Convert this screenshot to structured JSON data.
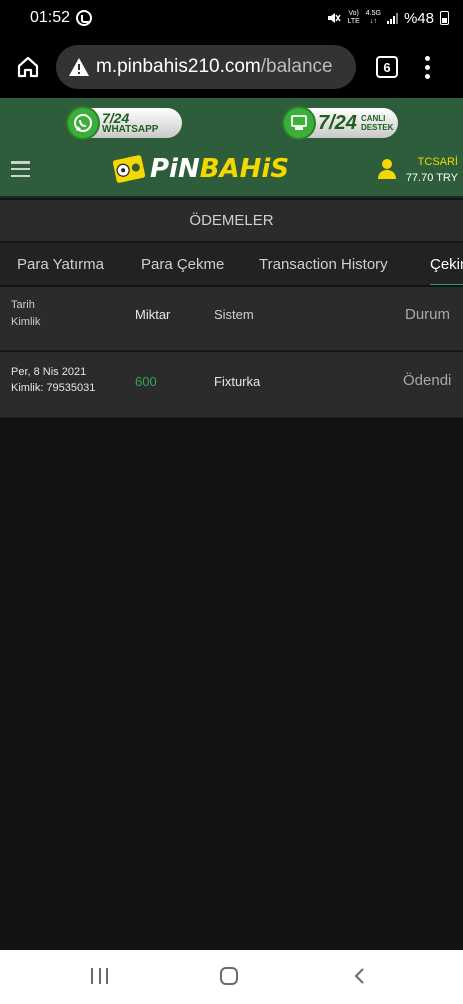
{
  "status_bar": {
    "time": "01:52",
    "network_top": "Vo)",
    "network_bottom": "LTE",
    "speed_top": "4.5G",
    "speed_bottom": "↓↑",
    "battery": "%48"
  },
  "browser": {
    "url_domain": "m.pinbahis210.com",
    "url_path": "/balance",
    "tab_count": "6"
  },
  "site_header": {
    "promo_whatsapp_line1": "7/24",
    "promo_whatsapp_line2": "WHATSAPP",
    "promo_live_big": "7/24",
    "promo_live_line1": "CANLI",
    "promo_live_line2": "DESTEK",
    "logo_white": "PiN",
    "logo_yellow": "BAHiS",
    "username": "TCSARİ",
    "balance": "77.70 TRY",
    "colors": {
      "header_bg": "#2d5d3a",
      "accent_yellow": "#f5d800",
      "accent_green": "#23a15a"
    }
  },
  "page": {
    "section_title": "ÖDEMELER",
    "tabs": [
      {
        "label": "Para Yatırma"
      },
      {
        "label": "Para Çekme"
      },
      {
        "label": "Transaction History"
      },
      {
        "label": "Çekim",
        "active": true
      }
    ]
  },
  "table": {
    "headers": {
      "date": "Tarih",
      "id": "Kimlik",
      "amount": "Miktar",
      "system": "Sistem",
      "status": "Durum"
    },
    "rows": [
      {
        "date": "Per, 8 Nis 2021",
        "id": "Kimlik: 79535031",
        "amount": "600",
        "system": "Fixturka",
        "status": "Ödendi"
      }
    ]
  },
  "icons": [
    "whatsapp-icon",
    "home-icon",
    "warning-icon",
    "tabs-icon",
    "more-menu-icon",
    "hamburger-icon",
    "user-icon",
    "nav-recent-icon",
    "nav-home-icon",
    "nav-back-icon"
  ]
}
